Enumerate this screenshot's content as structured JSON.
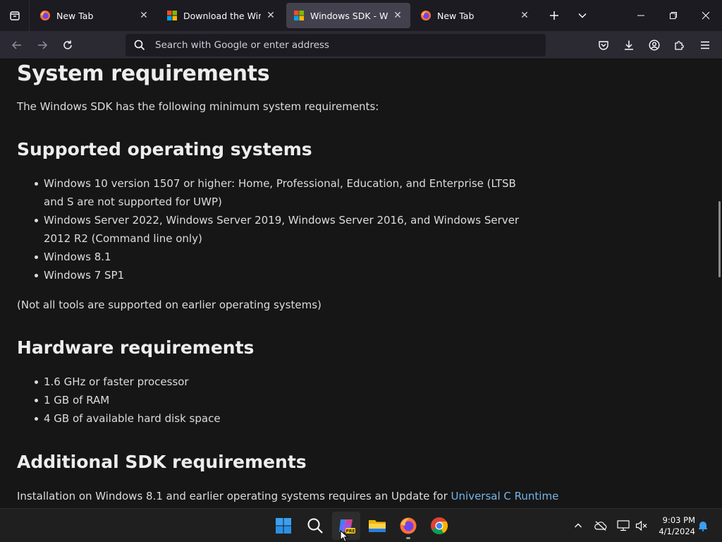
{
  "browser": {
    "tabs": [
      {
        "title": "New Tab",
        "favicon": "firefox-icon",
        "active": false
      },
      {
        "title": "Download the Windows",
        "favicon": "microsoft-icon",
        "active": false
      },
      {
        "title": "Windows SDK - Windows",
        "favicon": "microsoft-icon",
        "active": true
      },
      {
        "title": "New Tab",
        "favicon": "firefox-icon",
        "active": false
      }
    ],
    "urlbar": {
      "placeholder": "Search with Google or enter address"
    }
  },
  "page": {
    "title": "System requirements",
    "intro": "The Windows SDK has the following minimum system requirements:",
    "os_section": {
      "heading": "Supported operating systems",
      "items": [
        "Windows 10 version 1507 or higher: Home, Professional, Education, and Enterprise (LTSB and S are not supported for UWP)",
        "Windows Server 2022, Windows Server 2019, Windows Server 2016, and Windows Server 2012 R2 (Command line only)",
        "Windows 8.1",
        "Windows 7 SP1"
      ],
      "note": "(Not all tools are supported on earlier operating systems)"
    },
    "hw_section": {
      "heading": "Hardware requirements",
      "items": [
        "1.6 GHz or faster processor",
        "1 GB of RAM",
        "4 GB of available hard disk space"
      ]
    },
    "additional_section": {
      "heading": "Additional SDK requirements",
      "text": "Installation on Windows 8.1 and earlier operating systems requires an Update for",
      "link": "Universal C Runtime"
    }
  },
  "taskbar": {
    "time": "9:03 PM",
    "date": "4/1/2024",
    "copilot_badge": "PRE"
  },
  "colors": {
    "link": "#75b6e7",
    "active_tab": "#42414d",
    "background": "#161616"
  }
}
